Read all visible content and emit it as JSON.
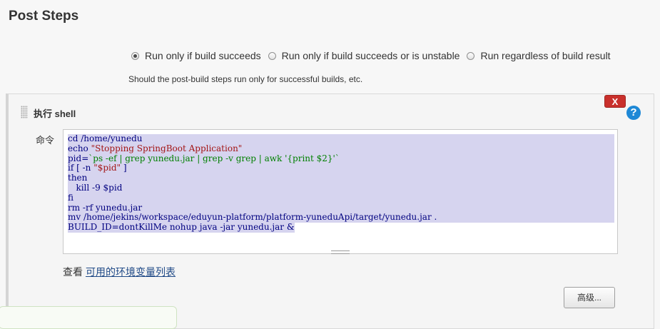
{
  "section": {
    "title": "Post Steps"
  },
  "post_steps": {
    "options": [
      {
        "label": "Run only if build succeeds",
        "checked": true
      },
      {
        "label": "Run only if build succeeds or is unstable",
        "checked": false
      },
      {
        "label": "Run regardless of build result",
        "checked": false
      }
    ],
    "description": "Should the post-build steps run only for successful builds, etc."
  },
  "step": {
    "title": "执行 shell",
    "delete_label": "X",
    "help_label": "?",
    "command_label": "命令",
    "command_lines": [
      [
        {
          "t": "cd /home/yunedu"
        }
      ],
      [
        {
          "t": "echo "
        },
        {
          "t": "\"Stopping SpringBoot Application\"",
          "c": "str"
        }
      ],
      [
        {
          "t": "pid="
        },
        {
          "t": "`ps -ef | grep yunedu.jar | grep -v grep | awk '{print $2}'`",
          "c": "grn"
        }
      ],
      [
        {
          "t": "if [ -n "
        },
        {
          "t": "\"$pid\"",
          "c": "str"
        },
        {
          "t": " ]"
        }
      ],
      [
        {
          "t": "then"
        }
      ],
      [
        {
          "t": "   kill -9 $pid"
        }
      ],
      [
        {
          "t": "fi"
        }
      ],
      [
        {
          "t": "rm -rf yunedu.jar"
        }
      ],
      [
        {
          "t": "mv /home/jekins/workspace/eduyun-platform/platform-yuneduApi/target/yunedu.jar ."
        }
      ],
      [
        {
          "t": "BUILD_ID=dontKillMe nohup java -jar yunedu.jar &"
        }
      ]
    ],
    "env_prefix": "查看",
    "env_link": "可用的环境变量列表",
    "advanced_label": "高级..."
  },
  "colors": {
    "selection": "#d6d4ef",
    "keyword": "#000080",
    "string": "#a31515",
    "backtick": "#008000",
    "delete": "#c9302c",
    "help": "#1e88d6"
  }
}
